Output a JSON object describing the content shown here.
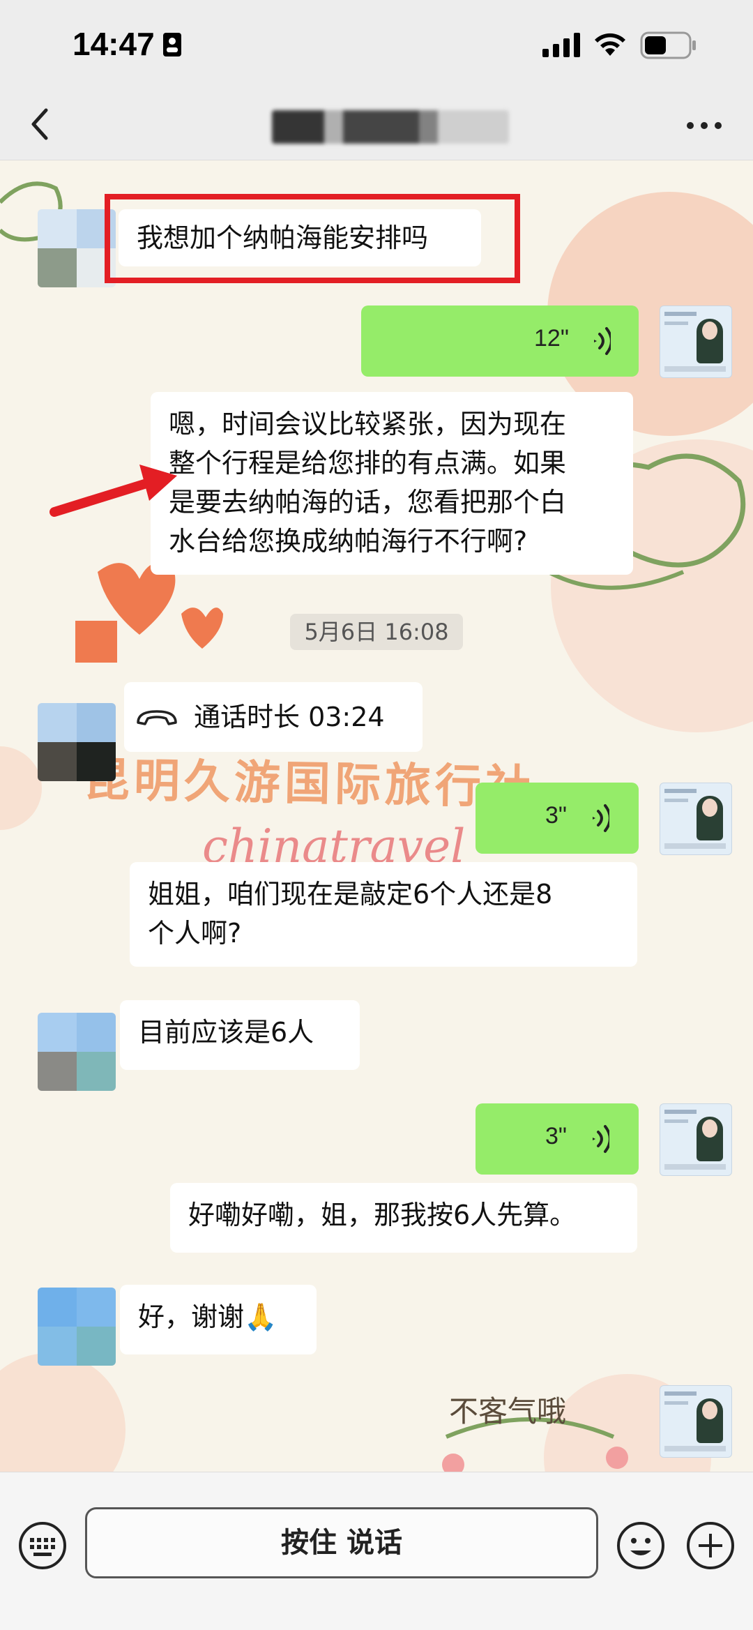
{
  "status_bar": {
    "time": "14:47"
  },
  "nav": {
    "back_icon": "chevron-left-icon",
    "more_icon": "ellipsis-icon"
  },
  "colors": {
    "self_bubble": "#95ec69",
    "other_bubble": "#ffffff",
    "highlight": "#e31e24",
    "chat_bg": "#f8f4ea"
  },
  "watermark": {
    "line1": "昆明久游国际旅行社",
    "line2": "chinatravel",
    "sticker_text": "不客气哦"
  },
  "messages": [
    {
      "sender": "other",
      "type": "text",
      "text": "我想加个纳帕海能安排吗",
      "highlighted": true
    },
    {
      "sender": "self",
      "type": "voice",
      "duration": "12\""
    },
    {
      "sender": "self",
      "type": "text",
      "text": "嗯，时间会议比较紧张，因为现在\n整个行程是给您排的有点满。如果\n是要去纳帕海的话，您看把那个白\n水台给您换成纳帕海行不行啊?",
      "annotated_with_arrow": true
    },
    {
      "type": "timestamp",
      "text": "5月6日 16:08"
    },
    {
      "sender": "other",
      "type": "call",
      "icon": "phone-hangup-icon",
      "text": "通话时长 03:24"
    },
    {
      "sender": "self",
      "type": "voice",
      "duration": "3\""
    },
    {
      "sender": "self",
      "type": "text",
      "text": "姐姐，咱们现在是敲定6个人还是8\n个人啊?"
    },
    {
      "sender": "other",
      "type": "text",
      "text": "目前应该是6人"
    },
    {
      "sender": "self",
      "type": "voice",
      "duration": "3\""
    },
    {
      "sender": "self",
      "type": "text",
      "text": "好嘞好嘞，姐，那我按6人先算。"
    },
    {
      "sender": "other",
      "type": "text",
      "text": "好，谢谢🙏"
    },
    {
      "sender": "self",
      "type": "sticker",
      "text": "不客气哦"
    }
  ],
  "input_bar": {
    "hold_to_talk_label": "按住 说话",
    "keyboard_icon": "keyboard-icon",
    "emoji_icon": "emoji-icon",
    "plus_icon": "plus-icon"
  }
}
